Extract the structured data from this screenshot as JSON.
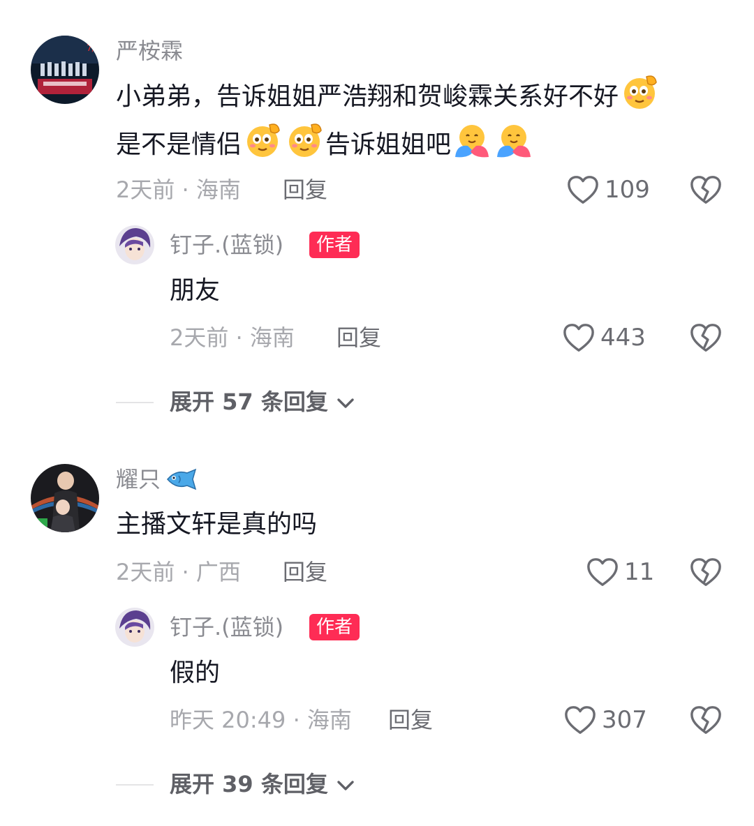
{
  "comments": [
    {
      "username": "严桉霖",
      "text_parts": [
        "小弟弟，告诉姐姐严浩翔和贺峻霖关系好不好",
        "是不是情侣",
        "告诉姐姐吧"
      ],
      "meta": "2天前 · 海南",
      "reply_label": "回复",
      "likes": "109",
      "reply": {
        "username": "钉子.(蓝锁)",
        "badge": "作者",
        "text": "朋友",
        "meta": "2天前 · 海南",
        "reply_label": "回复",
        "likes": "443"
      },
      "expand_label": "展开 57 条回复"
    },
    {
      "username": "耀只",
      "text": "主播文轩是真的吗",
      "meta": "2天前 · 广西",
      "reply_label": "回复",
      "likes": "11",
      "reply": {
        "username": "钉子.(蓝锁)",
        "badge": "作者",
        "text": "假的",
        "meta": "昨天 20:49 · 海南",
        "reply_label": "回复",
        "likes": "307"
      },
      "expand_label": "展开 39 条回复"
    }
  ],
  "icons": {
    "like": "heart-outline-icon",
    "dislike": "broken-heart-icon",
    "expand": "chevron-down-icon",
    "username_emoji": "fish-emoji-icon",
    "emoji_a": "salute-face-emoji",
    "emoji_b": "hugging-face-emoji"
  },
  "colors": {
    "badge": "#fe2c55",
    "meta": "#a7a8ad"
  }
}
